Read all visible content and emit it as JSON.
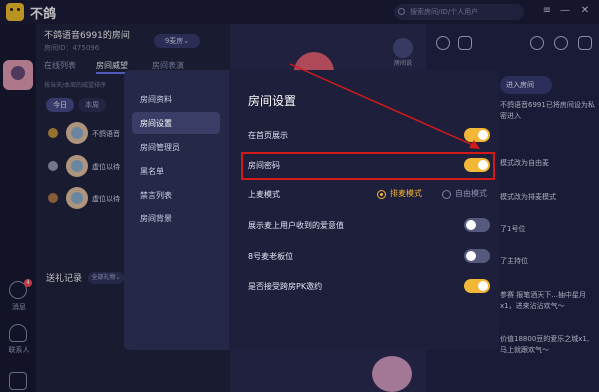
{
  "app": {
    "title": "不鸽",
    "search_placeholder": "搜索房间/ID/个人用户"
  },
  "room": {
    "name": "不鸽语音6991的房间",
    "id_text": "房间ID：475096",
    "seat_mode_btn": "9麦房⌄",
    "tabs": [
      {
        "label": "在线列表"
      },
      {
        "label": "房间威望"
      },
      {
        "label": "房间表演"
      }
    ],
    "sub_note": "按当天/本周的威望排序",
    "period_today": "今日",
    "period_week": "本周",
    "users": [
      {
        "name": "不鸽语音"
      },
      {
        "name": "虚位以待"
      },
      {
        "name": "虚位以待"
      }
    ],
    "gift_record": "送礼记录",
    "gift_filter": "全部礼物⌄"
  },
  "nav": {
    "messages": "消息",
    "messages_badge": "4",
    "contacts": "联系人"
  },
  "stage": {
    "mic_label": "房间说"
  },
  "chat": {
    "enter_room": "进入房间",
    "lines": [
      {
        "text": "不鸽语音6991已将房间设为私密进入"
      },
      {
        "text": "模式改为自由麦"
      },
      {
        "text": "模式改为排麦模式"
      },
      {
        "text": "了1号位"
      },
      {
        "text": "了主持位"
      },
      {
        "text": "参赛 报笔洒天下...抽中星月x1，进来沾沾欢气～"
      },
      {
        "text": "价值18800豆的爱乐之城x1,马上就跟欢气～"
      }
    ]
  },
  "dialog": {
    "title": "房间设置",
    "menu": [
      {
        "label": "房间资料"
      },
      {
        "label": "房间设置"
      },
      {
        "label": "房间管理员"
      },
      {
        "label": "黑名单"
      },
      {
        "label": "禁言列表"
      },
      {
        "label": "房间背景"
      }
    ],
    "settings": [
      {
        "label": "在首页展示",
        "enabled": true
      },
      {
        "label": "房间密码",
        "enabled": true
      },
      {
        "label": "上麦模式",
        "option_a": "排麦模式",
        "option_b": "自由模式",
        "selected": "排麦模式"
      },
      {
        "label": "展示麦上用户收到的爱意值",
        "enabled": false
      },
      {
        "label": "8号麦老板位",
        "enabled": false
      },
      {
        "label": "是否接受跨房PK邀约",
        "enabled": true
      }
    ]
  },
  "colors": {
    "accent_yellow": "#f2b737",
    "highlight_red": "#d21a1a"
  }
}
